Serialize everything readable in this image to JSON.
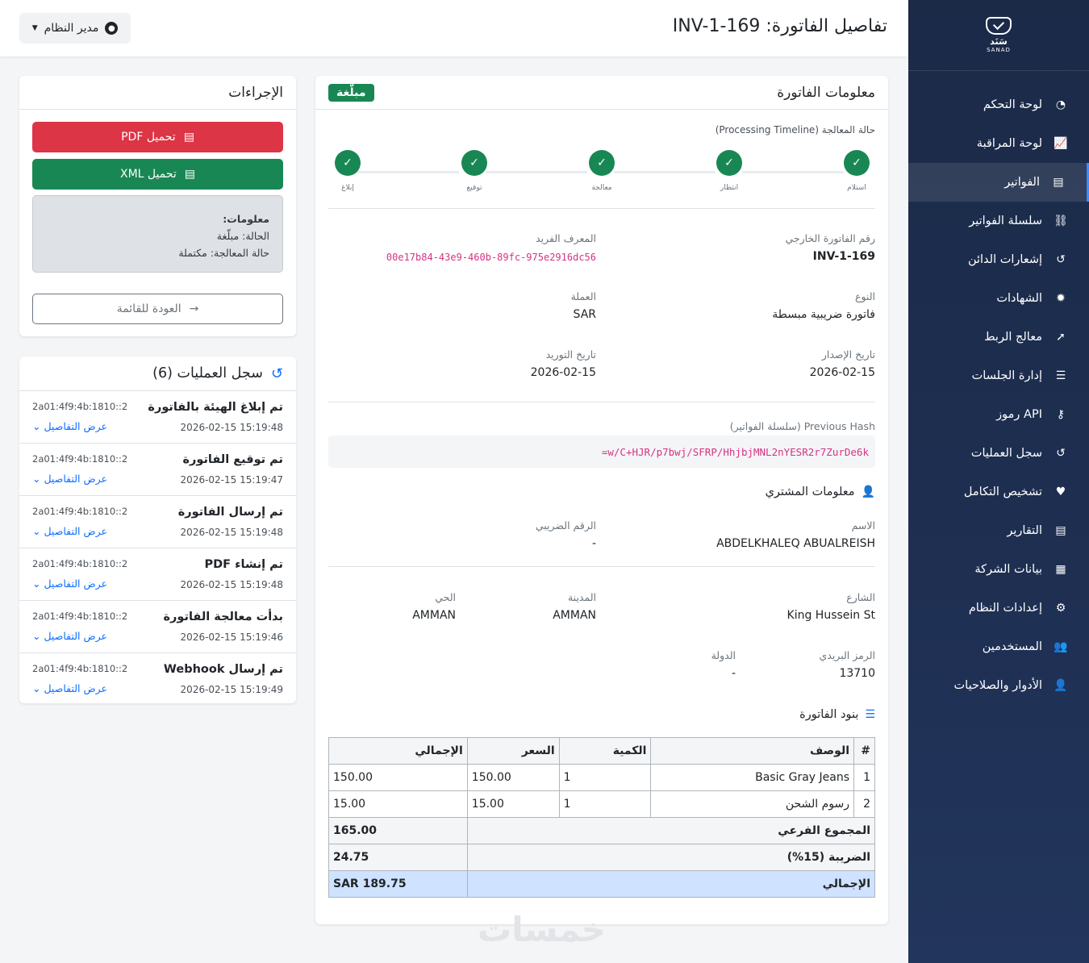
{
  "sidebar": {
    "logo_name": "سَنَد",
    "logo_en": "SANAD",
    "items": [
      {
        "label": "لوحة التحكم",
        "icon": "gauge-icon",
        "glyph": "◔"
      },
      {
        "label": "لوحة المراقبة",
        "icon": "chart-line-icon",
        "glyph": "📈"
      },
      {
        "label": "الفواتير",
        "icon": "invoice-file-icon",
        "glyph": "▤"
      },
      {
        "label": "سلسلة الفواتير",
        "icon": "link-icon",
        "glyph": "⛓"
      },
      {
        "label": "إشعارات الدائن",
        "icon": "undo-icon",
        "glyph": "↺"
      },
      {
        "label": "الشهادات",
        "icon": "certificate-icon",
        "glyph": "✹"
      },
      {
        "label": "معالج الربط",
        "icon": "rocket-icon",
        "glyph": "➚"
      },
      {
        "label": "إدارة الجلسات",
        "icon": "list-icon",
        "glyph": "☰"
      },
      {
        "label": "رموز API",
        "icon": "key-icon",
        "glyph": "⚷"
      },
      {
        "label": "سجل العمليات",
        "icon": "history-icon",
        "glyph": "↺"
      },
      {
        "label": "تشخيص التكامل",
        "icon": "heartbeat-icon",
        "glyph": "♥"
      },
      {
        "label": "التقارير",
        "icon": "csv-file-icon",
        "glyph": "▤"
      },
      {
        "label": "بيانات الشركة",
        "icon": "building-icon",
        "glyph": "▦"
      },
      {
        "label": "إعدادات النظام",
        "icon": "gears-icon",
        "glyph": "⚙"
      },
      {
        "label": "المستخدمين",
        "icon": "users-icon",
        "glyph": "👥"
      },
      {
        "label": "الأدوار والصلاحيات",
        "icon": "user-lock-icon",
        "glyph": "👤"
      }
    ],
    "active_index": 2
  },
  "header": {
    "title": "تفاصيل الفاتورة: INV-1-169",
    "user_label": "مدير النظام"
  },
  "invoice_card": {
    "title": "معلومات الفاتورة",
    "status_badge": "مبلّغة",
    "timeline_label": "حالة المعالجة (Processing Timeline)",
    "timeline_steps": [
      "استلام",
      "انتظار",
      "معالجة",
      "توقيع",
      "إبلاغ"
    ],
    "fields": {
      "external_number_label": "رقم الفاتورة الخارجي",
      "external_number": "INV-1-169",
      "uuid_label": "المعرف الفريد",
      "uuid": "00e17b84-43e9-460b-89fc-975e2916dc56",
      "type_label": "النوع",
      "type": "فاتورة ضريبية مبسطة",
      "currency_label": "العملة",
      "currency": "SAR",
      "issue_date_label": "تاريخ الإصدار",
      "issue_date": "2026-02-15",
      "supply_date_label": "تاريخ التوريد",
      "supply_date": "2026-02-15"
    },
    "prev_hash_label": "Previous Hash (سلسلة الفواتير)",
    "prev_hash": "=w/C+HJR/p7bwj/SFRP/HhjbjMNL2nYESR2r7ZurDe6k",
    "buyer": {
      "title": "معلومات المشتري",
      "name_label": "الاسم",
      "name": "ABDELKHALEQ ABUALREISH",
      "tax_label": "الرقم الضريبي",
      "tax": "-",
      "street_label": "الشارع",
      "street": "King Hussein St",
      "city_label": "المدينة",
      "city": "AMMAN",
      "district_label": "الحي",
      "district": "AMMAN",
      "postal_label": "الرمز البريدي",
      "postal": "13710",
      "country_label": "الدولة",
      "country": "-"
    },
    "items_title": "بنود الفاتورة",
    "table": {
      "headers": [
        "#",
        "الوصف",
        "الكمية",
        "السعر",
        "الإجمالي"
      ],
      "rows": [
        [
          "1",
          "Basic Gray Jeans",
          "1",
          "150.00",
          "150.00"
        ],
        [
          "2",
          "رسوم الشحن",
          "1",
          "15.00",
          "15.00"
        ]
      ],
      "subtotal_label": "المجموع الفرعي",
      "subtotal": "165.00",
      "tax_label": "الضريبة (15%)",
      "tax": "24.75",
      "total_label": "الإجمالي",
      "total": "SAR 189.75"
    }
  },
  "actions": {
    "title": "الإجراءات",
    "pdf_button": "تحميل PDF",
    "xml_button": "تحميل XML",
    "info_title": "معلومات:",
    "info_status": "الحالة: مبلّغة",
    "info_processing": "حالة المعالجة: مكتملة",
    "back_button": "العودة للقائمة"
  },
  "log": {
    "title": "سجل العمليات (6)",
    "details_link": "عرض التفاصيل",
    "entries": [
      {
        "title": "تم إبلاغ الهيئة بالفاتورة",
        "ip": "2a01:4f9:4b:1810::2",
        "time": "2026-02-15 15:19:48"
      },
      {
        "title": "تم توقيع الفاتورة",
        "ip": "2a01:4f9:4b:1810::2",
        "time": "2026-02-15 15:19:47"
      },
      {
        "title": "تم إرسال الفاتورة",
        "ip": "2a01:4f9:4b:1810::2",
        "time": "2026-02-15 15:19:48"
      },
      {
        "title": "تم إنشاء PDF",
        "ip": "2a01:4f9:4b:1810::2",
        "time": "2026-02-15 15:19:48"
      },
      {
        "title": "بدأت معالجة الفاتورة",
        "ip": "2a01:4f9:4b:1810::2",
        "time": "2026-02-15 15:19:46"
      },
      {
        "title": "تم إرسال Webhook",
        "ip": "2a01:4f9:4b:1810::2",
        "time": "2026-02-15 15:19:49"
      }
    ]
  },
  "watermark": "خمسات"
}
